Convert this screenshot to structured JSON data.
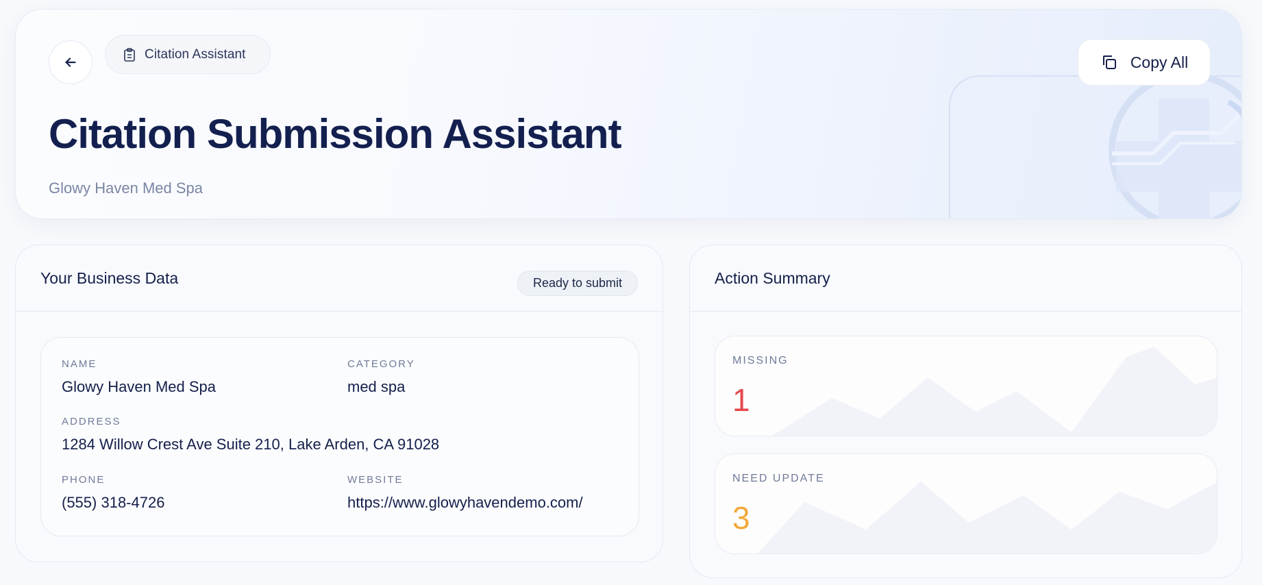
{
  "header": {
    "breadcrumb": "Citation Assistant",
    "title": "Citation Submission Assistant",
    "subtitle": "Glowy Haven Med Spa",
    "copy_all_label": "Copy All"
  },
  "business_panel": {
    "title": "Your Business Data",
    "status": "Ready to submit",
    "fields": {
      "name": {
        "label": "NAME",
        "value": "Glowy Haven Med Spa"
      },
      "category": {
        "label": "CATEGORY",
        "value": "med spa"
      },
      "address": {
        "label": "ADDRESS",
        "value": "1284 Willow Crest Ave Suite 210, Lake Arden, CA 91028"
      },
      "phone": {
        "label": "PHONE",
        "value": "(555) 318-4726"
      },
      "website": {
        "label": "WEBSITE",
        "value": "https://www.glowyhavendemo.com/"
      }
    }
  },
  "summary_panel": {
    "title": "Action Summary",
    "metrics": [
      {
        "label": "MISSING",
        "value": "1",
        "color": "#e5484d"
      },
      {
        "label": "NEED UPDATE",
        "value": "3",
        "color": "#f2a93b"
      }
    ]
  },
  "icons": {
    "back": "arrow-left-icon",
    "breadcrumb": "clipboard-icon",
    "copy": "copy-icon"
  }
}
